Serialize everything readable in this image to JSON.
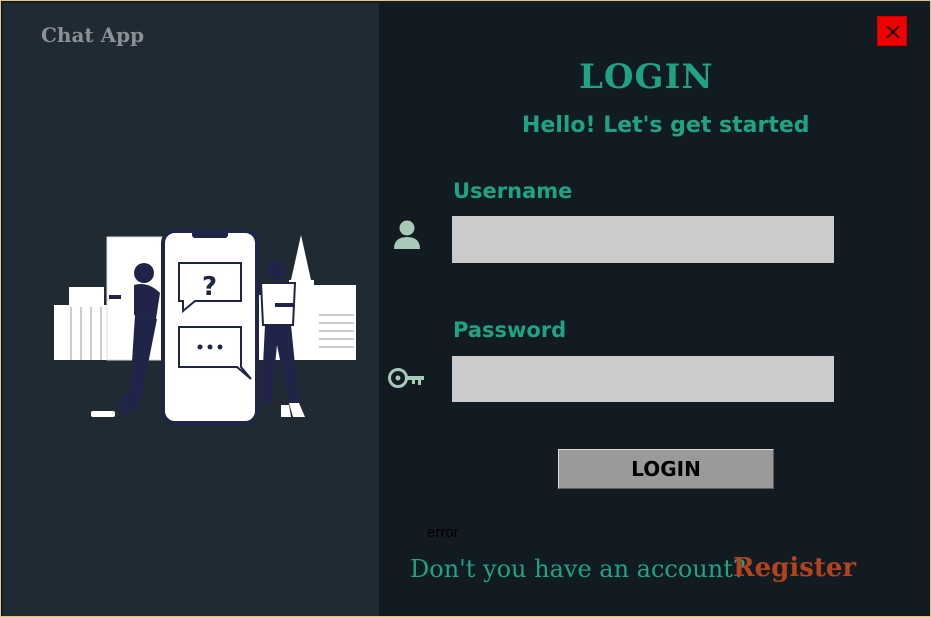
{
  "app": {
    "brand": "Chat App"
  },
  "login": {
    "title": "LOGIN",
    "subtitle": "Hello! Let's get started",
    "username_label": "Username",
    "username_value": "",
    "password_label": "Password",
    "password_value": "",
    "button_label": "LOGIN",
    "error_text": "error",
    "no_account_text": "Don't you have an account?",
    "register_link": "Register"
  },
  "icons": {
    "close": "close-icon",
    "user": "user-icon",
    "key": "key-icon"
  },
  "colors": {
    "left_panel": "#202a32",
    "right_panel": "#121a22",
    "accent": "#1ea384",
    "register": "#b3431c",
    "close_button": "#f10000",
    "field_bg": "#cbcbcb",
    "button_bg": "#9a9a9a"
  }
}
